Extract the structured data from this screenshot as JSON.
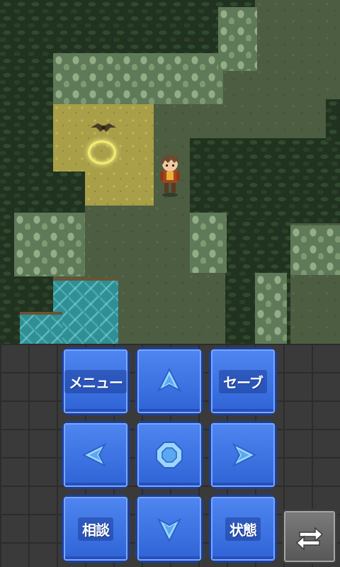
{
  "controls": {
    "menu_label": "メニュー",
    "save_label": "セーブ",
    "consult_label": "相談",
    "status_label": "状態"
  },
  "icons": {
    "up": "arrow-up-icon",
    "down": "arrow-down-icon",
    "left": "arrow-left-icon",
    "right": "arrow-right-icon",
    "center": "octagon-action-icon",
    "toggle": "swap-arrows-icon"
  },
  "colors": {
    "button_blue": "#3a6fe0",
    "button_border": "#1b3f9a",
    "toggle_gray": "#6a6a6a",
    "warp_glow": "#f4ec6a"
  }
}
